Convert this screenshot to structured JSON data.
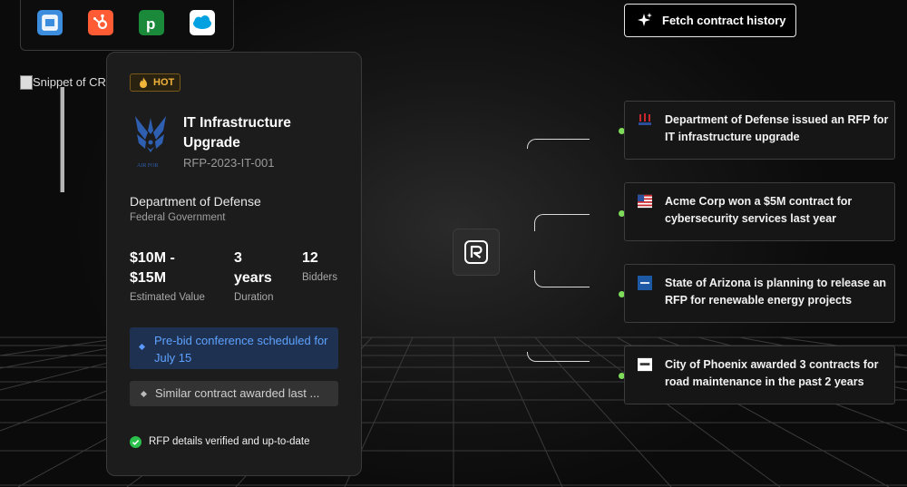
{
  "integrations": {
    "items": [
      {
        "name": "tv-app-icon",
        "color": "#3c8dde"
      },
      {
        "name": "hubspot-icon",
        "color": "#ff5c35"
      },
      {
        "name": "pipedrive-icon",
        "color": "#1a8a3a"
      },
      {
        "name": "salesforce-icon",
        "color": "#00a1e0"
      }
    ]
  },
  "snippet_image": {
    "alt": "Snippet of CRM"
  },
  "rfp_card": {
    "badge": "HOT",
    "title": "IT Infrastructure Upgrade",
    "id": "RFP-2023-IT-001",
    "agency_logo_text": "AIR FOR",
    "department": "Department of Defense",
    "department_type": "Federal Government",
    "stats": {
      "value_line1": "$10M -",
      "value_line2": "$15M",
      "value_label": "Estimated Value",
      "duration_line1": "3",
      "duration_line2": "years",
      "duration_label": "Duration",
      "bidders": "12",
      "bidders_label": "Bidders"
    },
    "notice": "Pre-bid conference scheduled for July 15",
    "similar": "Similar contract awarded last ...",
    "verified": "RFP details verified and up-to-date"
  },
  "fetch_button": {
    "label": "Fetch contract history"
  },
  "insights": [
    {
      "text": "Department of Defense issued an RFP for IT infrastructure upgrade",
      "icon": "dod-seal-icon"
    },
    {
      "text": "Acme Corp won a $5M contract for cybersecurity services last year",
      "icon": "us-flag-icon"
    },
    {
      "text": "State of Arizona is planning to release an RFP for renewable energy projects",
      "icon": "arizona-logo-icon"
    },
    {
      "text": "City of Phoenix awarded 3 contracts for road maintenance in the past 2 years",
      "icon": "phoenix-logo-icon"
    }
  ],
  "colors": {
    "accent_blue": "#5ea2ff",
    "hot_orange": "#f0b43a",
    "connector_dot": "#7fdc5a",
    "verified_green": "#2bbf4b"
  }
}
